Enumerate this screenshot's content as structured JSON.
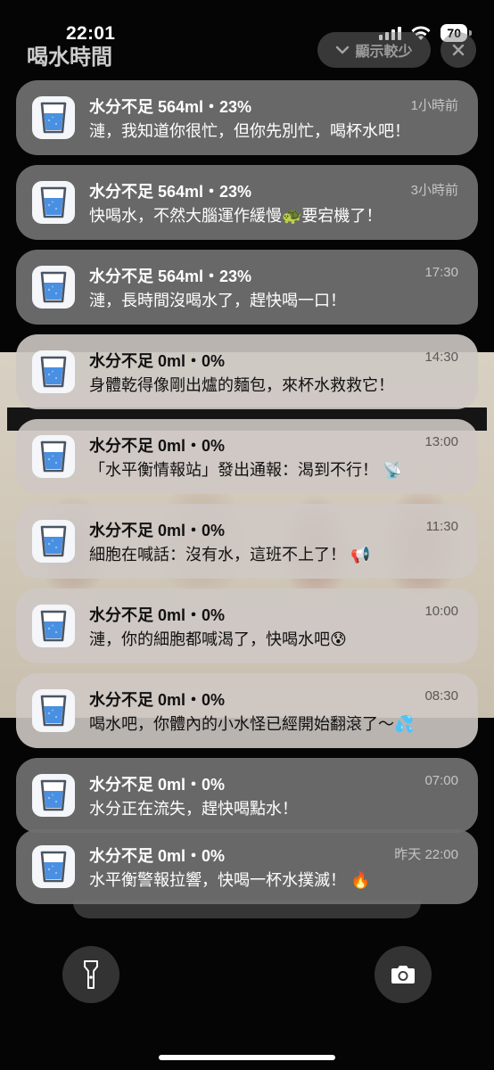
{
  "status_bar": {
    "time": "22:01",
    "battery": "70"
  },
  "group": {
    "title": "喝水時間",
    "show_less_label": "顯示較少",
    "close_icon": "close-icon"
  },
  "notifications": [
    {
      "title": "水分不足 564ml・23%",
      "time": "1小時前",
      "body": "漣，我知道你很忙，但你先別忙，喝杯水吧！"
    },
    {
      "title": "水分不足 564ml・23%",
      "time": "3小時前",
      "body": "快喝水，不然大腦運作緩慢🐢要宕機了！"
    },
    {
      "title": "水分不足 564ml・23%",
      "time": "17:30",
      "body": "漣，長時間沒喝水了，趕快喝一口！"
    },
    {
      "title": "水分不足 0ml・0%",
      "time": "14:30",
      "body": "身體乾得像剛出爐的麵包，來杯水救救它！"
    },
    {
      "title": "水分不足 0ml・0%",
      "time": "13:00",
      "body": "「水平衡情報站」發出通報：渴到不行！ 📡"
    },
    {
      "title": "水分不足 0ml・0%",
      "time": "11:30",
      "body": "細胞在喊話：沒有水，這班不上了！ 📢"
    },
    {
      "title": "水分不足 0ml・0%",
      "time": "10:00",
      "body": "漣，你的細胞都喊渴了，快喝水吧😰"
    },
    {
      "title": "水分不足 0ml・0%",
      "time": "08:30",
      "body": "喝水吧，你體內的小水怪已經開始翻滾了～💦"
    },
    {
      "title": "水分不足 0ml・0%",
      "time": "07:00",
      "body": "水分正在流失，趕快喝點水！"
    },
    {
      "title": "水分不足 0ml・0%",
      "time": "昨天 22:00",
      "body": "水平衡警報拉響，快喝一杯水撲滅！ 🔥"
    }
  ],
  "icons": {
    "app": "water-glass-icon",
    "flashlight": "flashlight-icon",
    "camera": "camera-icon"
  }
}
